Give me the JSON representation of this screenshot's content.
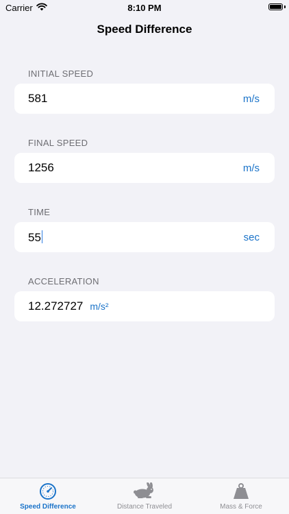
{
  "status": {
    "carrier": "Carrier",
    "time": "8:10 PM"
  },
  "nav": {
    "title": "Speed Difference"
  },
  "fields": {
    "initial": {
      "label": "INITIAL SPEED",
      "value": "581",
      "unit": "m/s"
    },
    "final": {
      "label": "FINAL SPEED",
      "value": "1256",
      "unit": "m/s"
    },
    "time": {
      "label": "TIME",
      "value": "55",
      "unit": "sec"
    },
    "acceleration": {
      "label": "ACCELERATION",
      "value": "12.272727",
      "unit": "m/s²"
    }
  },
  "tabs": [
    {
      "label": "Speed Difference",
      "icon": "speedometer-icon",
      "active": true
    },
    {
      "label": "Distance Traveled",
      "icon": "rabbit-icon",
      "active": false
    },
    {
      "label": "Mass & Force",
      "icon": "weight-icon",
      "active": false
    }
  ],
  "colors": {
    "accent": "#1a73c9",
    "background": "#f2f2f7",
    "inactive": "#8e8e93"
  }
}
